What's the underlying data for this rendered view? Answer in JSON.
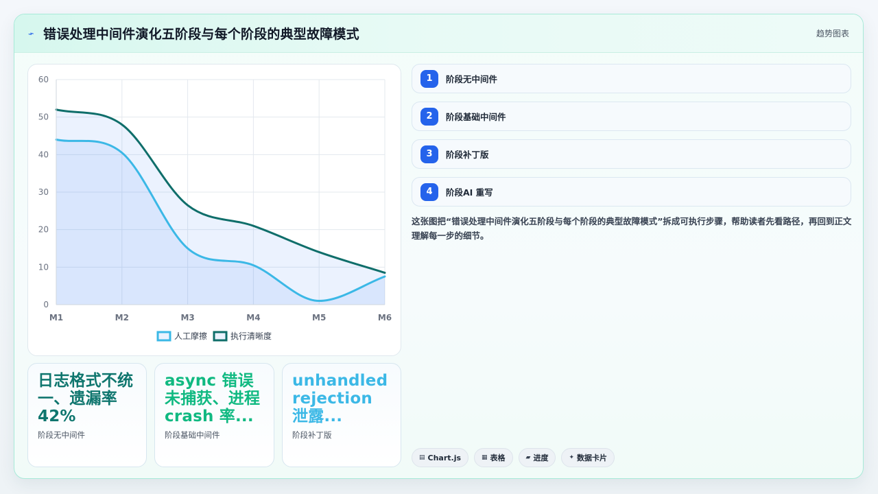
{
  "header": {
    "title": "错误处理中间件演化五阶段与每个阶段的典型故障模式",
    "icon": "lightning-icon",
    "right_label": "趋势图表"
  },
  "chart_data": {
    "type": "area",
    "categories": [
      "M1",
      "M2",
      "M3",
      "M4",
      "M5",
      "M6"
    ],
    "ylim": [
      0,
      60
    ],
    "yticks": [
      0,
      10,
      20,
      30,
      40,
      50,
      60
    ],
    "grid": true,
    "legend_position": "bottom",
    "series": [
      {
        "name": "人工摩擦",
        "values": [
          44,
          40.5,
          15,
          10.5,
          1,
          7.5
        ],
        "color": "#3bb8e6",
        "fill": "rgba(59,130,246,0.10)"
      },
      {
        "name": "执行清晰度",
        "values": [
          52,
          48,
          26.5,
          21,
          14,
          8.5
        ],
        "color": "#0f6e6a",
        "fill": "rgba(59,130,246,0.10)"
      }
    ]
  },
  "steps": [
    {
      "number": "1",
      "label": "阶段无中间件"
    },
    {
      "number": "2",
      "label": "阶段基础中间件"
    },
    {
      "number": "3",
      "label": "阶段补丁版"
    },
    {
      "number": "4",
      "label": "阶段AI 重写"
    }
  ],
  "description": "这张图把“错误处理中间件演化五阶段与每个阶段的典型故障模式”拆成可执行步骤，帮助读者先看路径，再回到正文理解每一步的细节。",
  "stats": [
    {
      "value": "日志格式不统一、遗漏率 42%",
      "label": "阶段无中间件",
      "color": "#0f766e"
    },
    {
      "value": "async 错误未捕获、进程 crash 率...",
      "label": "阶段基础中间件",
      "color": "#10b981"
    },
    {
      "value": "unhandled rejection 泄露...",
      "label": "阶段补丁版",
      "color": "#3bb8e6"
    }
  ],
  "tags": [
    {
      "icon": "chart-icon",
      "glyph": "▤",
      "label": "Chart.js"
    },
    {
      "icon": "table-icon",
      "glyph": "▦",
      "label": "表格"
    },
    {
      "icon": "progress-icon",
      "glyph": "▰",
      "label": "进度"
    },
    {
      "icon": "sparkle-icon",
      "glyph": "✦",
      "label": "数据卡片"
    }
  ]
}
